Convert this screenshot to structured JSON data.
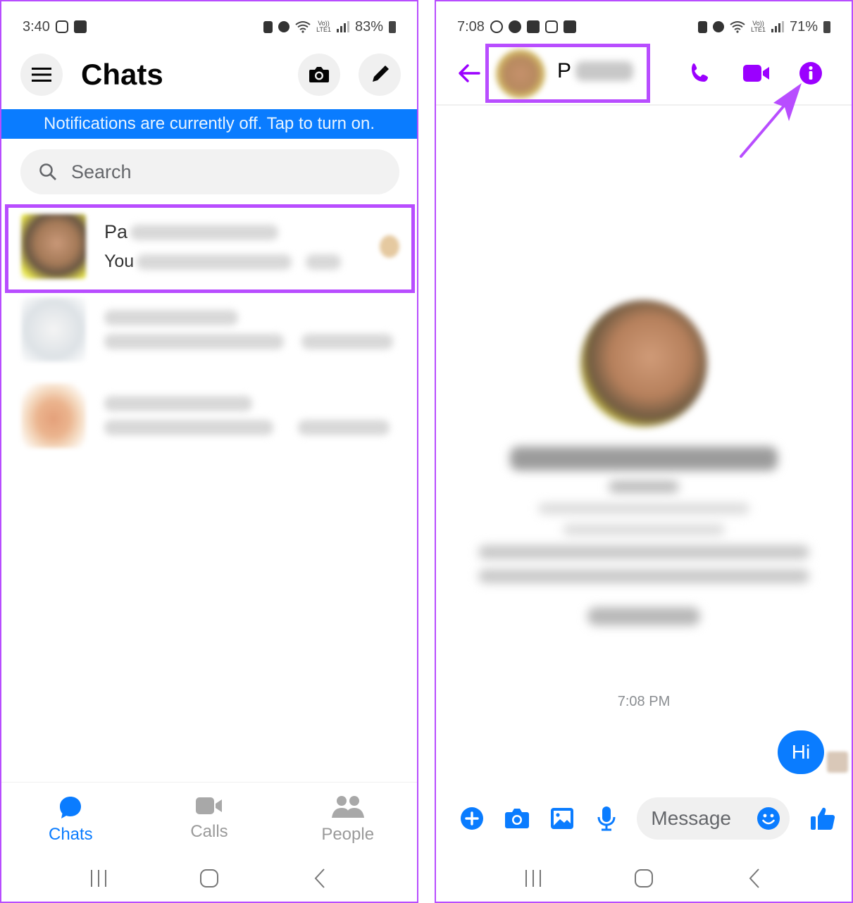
{
  "colors": {
    "messenger_blue": "#0a7cff",
    "annotation_purple": "#b84dff",
    "header_icon_purple": "#9b00ff",
    "inactive_gray": "#9a9a9a"
  },
  "left_screen": {
    "status_bar": {
      "time": "3:40",
      "left_icons": [
        "instagram-icon",
        "gallery-icon"
      ],
      "right_icons": [
        "battery-saver-icon",
        "alarm-icon",
        "wifi-icon",
        "volte-lte1-icon",
        "signal-icon"
      ],
      "volte_label": "Vo))",
      "lte_label": "LTE1",
      "battery": "83%"
    },
    "header": {
      "title": "Chats",
      "menu_icon": "hamburger-menu-icon",
      "camera_icon": "camera-icon",
      "compose_icon": "pencil-icon"
    },
    "notification_banner": "Notifications are currently off. Tap to turn on.",
    "search": {
      "placeholder": "Search",
      "value": ""
    },
    "chats": [
      {
        "name_visible": "Pa",
        "preview_visible": "You",
        "highlighted": true,
        "name_blurred": true
      },
      {
        "name_visible": "",
        "preview_visible": "",
        "highlighted": false,
        "name_blurred": true
      },
      {
        "name_visible": "",
        "preview_visible": "",
        "highlighted": false,
        "name_blurred": true
      }
    ],
    "bottom_nav": [
      {
        "label": "Chats",
        "icon": "chat-bubble-icon",
        "active": true
      },
      {
        "label": "Calls",
        "icon": "video-camera-icon",
        "active": false
      },
      {
        "label": "People",
        "icon": "people-icon",
        "active": false
      }
    ],
    "system_nav": [
      "recent-apps",
      "home",
      "back"
    ]
  },
  "right_screen": {
    "status_bar": {
      "time": "7:08",
      "left_icons": [
        "whatsapp-icon",
        "messages-icon",
        "u-app-icon",
        "instagram-icon",
        "gallery-icon"
      ],
      "volte_label": "Vo))",
      "lte_label": "LTE1",
      "battery": "71%"
    },
    "header": {
      "contact_name_visible": "P",
      "name_blurred": true,
      "highlighted": true,
      "actions": [
        "back-arrow",
        "voice-call",
        "video-call",
        "info"
      ]
    },
    "conversation": {
      "timestamp": "7:08 PM",
      "messages": [
        {
          "text": "Hi",
          "outgoing": true
        }
      ]
    },
    "composer": {
      "placeholder": "Message",
      "value": "",
      "icons": [
        "plus-icon",
        "camera-icon",
        "gallery-icon",
        "microphone-icon",
        "emoji-icon",
        "thumbs-up-icon"
      ]
    },
    "annotation": "arrow-pointing-to-info-icon"
  }
}
